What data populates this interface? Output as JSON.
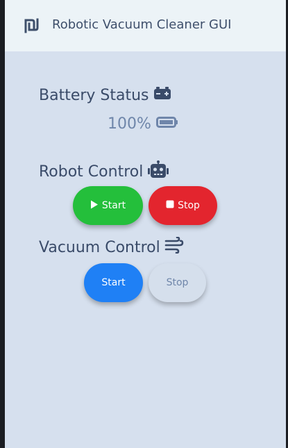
{
  "app": {
    "title": "Robotic Vacuum Cleaner GUI",
    "logo_icon": "shekel-logo-icon"
  },
  "battery": {
    "title": "Battery Status",
    "title_icon": "car-battery-icon",
    "level_text": "100%",
    "level_icon": "battery-full-icon",
    "level": 100
  },
  "robot_control": {
    "title": "Robot Control",
    "title_icon": "robot-icon",
    "start_label": "Start",
    "start_icon": "play-icon",
    "stop_label": "Stop",
    "stop_icon": "stop-icon"
  },
  "vacuum_control": {
    "title": "Vacuum Control",
    "title_icon": "wind-icon",
    "start_label": "Start",
    "stop_label": "Stop"
  },
  "colors": {
    "background": "#d6e0ee",
    "appbar": "#ecf3f7",
    "green": "#24bf3b",
    "red": "#e3252e",
    "blue": "#1f80f5",
    "text": "#3a4b69",
    "muted": "#6f86aa"
  }
}
